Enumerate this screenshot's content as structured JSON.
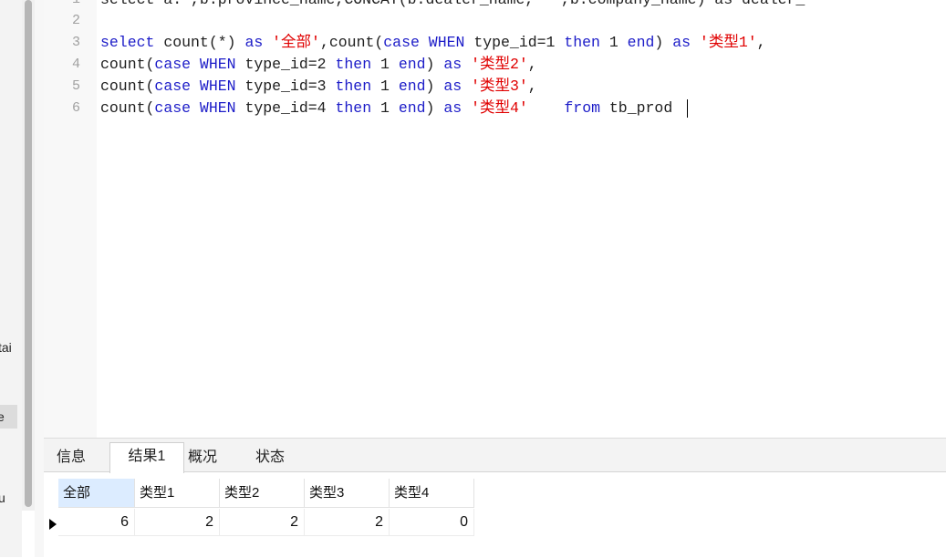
{
  "sidebar": {
    "items": [
      "tai",
      "e",
      "u"
    ]
  },
  "editor": {
    "lines": [
      {
        "num": "1",
        "segments": [
          {
            "t": "select a.*,b.province_name,CONCAT(b.dealer_name,'-',b.company_name) as dealer_",
            "c": "plain"
          }
        ]
      },
      {
        "num": "2",
        "segments": []
      },
      {
        "num": "3",
        "segments": [
          {
            "t": "select ",
            "c": "kw"
          },
          {
            "t": "count(*) ",
            "c": "fn"
          },
          {
            "t": "as ",
            "c": "kw"
          },
          {
            "t": "'全部'",
            "c": "str"
          },
          {
            "t": ",count(",
            "c": "fn"
          },
          {
            "t": "case WHEN ",
            "c": "kw"
          },
          {
            "t": "type_id=1 ",
            "c": "fn"
          },
          {
            "t": "then ",
            "c": "kw"
          },
          {
            "t": "1 ",
            "c": "fn"
          },
          {
            "t": "end",
            "c": "kw"
          },
          {
            "t": ") ",
            "c": "fn"
          },
          {
            "t": "as ",
            "c": "kw"
          },
          {
            "t": "'类型1'",
            "c": "str"
          },
          {
            "t": ",",
            "c": "fn"
          }
        ]
      },
      {
        "num": "4",
        "segments": [
          {
            "t": "count(",
            "c": "fn"
          },
          {
            "t": "case WHEN ",
            "c": "kw"
          },
          {
            "t": "type_id=2 ",
            "c": "fn"
          },
          {
            "t": "then ",
            "c": "kw"
          },
          {
            "t": "1 ",
            "c": "fn"
          },
          {
            "t": "end",
            "c": "kw"
          },
          {
            "t": ") ",
            "c": "fn"
          },
          {
            "t": "as ",
            "c": "kw"
          },
          {
            "t": "'类型2'",
            "c": "str"
          },
          {
            "t": ",",
            "c": "fn"
          }
        ]
      },
      {
        "num": "5",
        "segments": [
          {
            "t": "count(",
            "c": "fn"
          },
          {
            "t": "case WHEN ",
            "c": "kw"
          },
          {
            "t": "type_id=3 ",
            "c": "fn"
          },
          {
            "t": "then ",
            "c": "kw"
          },
          {
            "t": "1 ",
            "c": "fn"
          },
          {
            "t": "end",
            "c": "kw"
          },
          {
            "t": ") ",
            "c": "fn"
          },
          {
            "t": "as ",
            "c": "kw"
          },
          {
            "t": "'类型3'",
            "c": "str"
          },
          {
            "t": ",",
            "c": "fn"
          }
        ]
      },
      {
        "num": "6",
        "segments": [
          {
            "t": "count(",
            "c": "fn"
          },
          {
            "t": "case WHEN ",
            "c": "kw"
          },
          {
            "t": "type_id=4 ",
            "c": "fn"
          },
          {
            "t": "then ",
            "c": "kw"
          },
          {
            "t": "1 ",
            "c": "fn"
          },
          {
            "t": "end",
            "c": "kw"
          },
          {
            "t": ") ",
            "c": "fn"
          },
          {
            "t": "as ",
            "c": "kw"
          },
          {
            "t": "'类型4'",
            "c": "str"
          },
          {
            "t": "    ",
            "c": "fn"
          },
          {
            "t": "from ",
            "c": "kw"
          },
          {
            "t": "tb_prod ",
            "c": "fn"
          }
        ]
      }
    ]
  },
  "results": {
    "tabs": [
      {
        "label": "信息",
        "active": false
      },
      {
        "label": "结果1",
        "active": true
      },
      {
        "label": "概况",
        "active": false
      },
      {
        "label": "状态",
        "active": false
      }
    ],
    "columns": [
      "全部",
      "类型1",
      "类型2",
      "类型3",
      "类型4"
    ],
    "rows": [
      [
        "6",
        "2",
        "2",
        "2",
        "0"
      ]
    ]
  },
  "colors": {
    "keyword": "#1c1cc8",
    "string": "#e00000",
    "selected_header": "#dcecff"
  }
}
